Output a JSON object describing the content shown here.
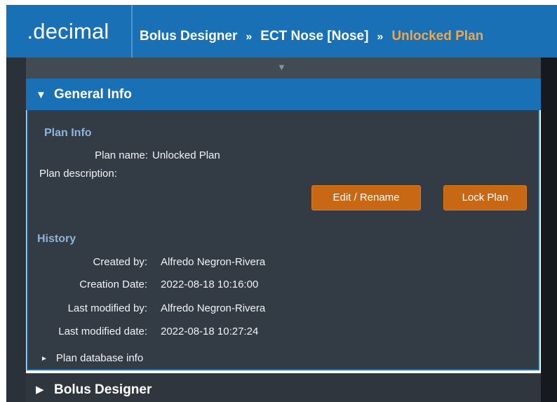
{
  "header": {
    "logo": ".decimal",
    "breadcrumb": [
      {
        "label": "Bolus Designer"
      },
      {
        "label": "ECT Nose [Nose]"
      },
      {
        "label": "Unlocked Plan"
      }
    ],
    "separator": "»"
  },
  "general_info": {
    "title": "General Info",
    "plan_info": {
      "heading": "Plan Info",
      "plan_name_label": "Plan name:",
      "plan_name_value": "Unlocked Plan",
      "plan_description_label": "Plan description:",
      "plan_description_value": ""
    },
    "buttons": {
      "edit_rename": "Edit / Rename",
      "lock_plan": "Lock Plan"
    },
    "history": {
      "heading": "History",
      "created_by_label": "Created by:",
      "created_by_value": "Alfredo Negron-Rivera",
      "creation_date_label": "Creation Date:",
      "creation_date_value": "2022-08-18 10:16:00",
      "last_modified_by_label": "Last modified by:",
      "last_modified_by_value": "Alfredo Negron-Rivera",
      "last_modified_date_label": "Last modified date:",
      "last_modified_date_value": "2022-08-18 10:27:24"
    },
    "plan_database_info": "Plan database info"
  },
  "bolus_designer": {
    "title": "Bolus Designer"
  },
  "colors": {
    "accent_blue": "#1a70b5",
    "button_orange": "#c86814",
    "current_crumb": "#f2a64a",
    "panel_bg": "#333b44"
  }
}
